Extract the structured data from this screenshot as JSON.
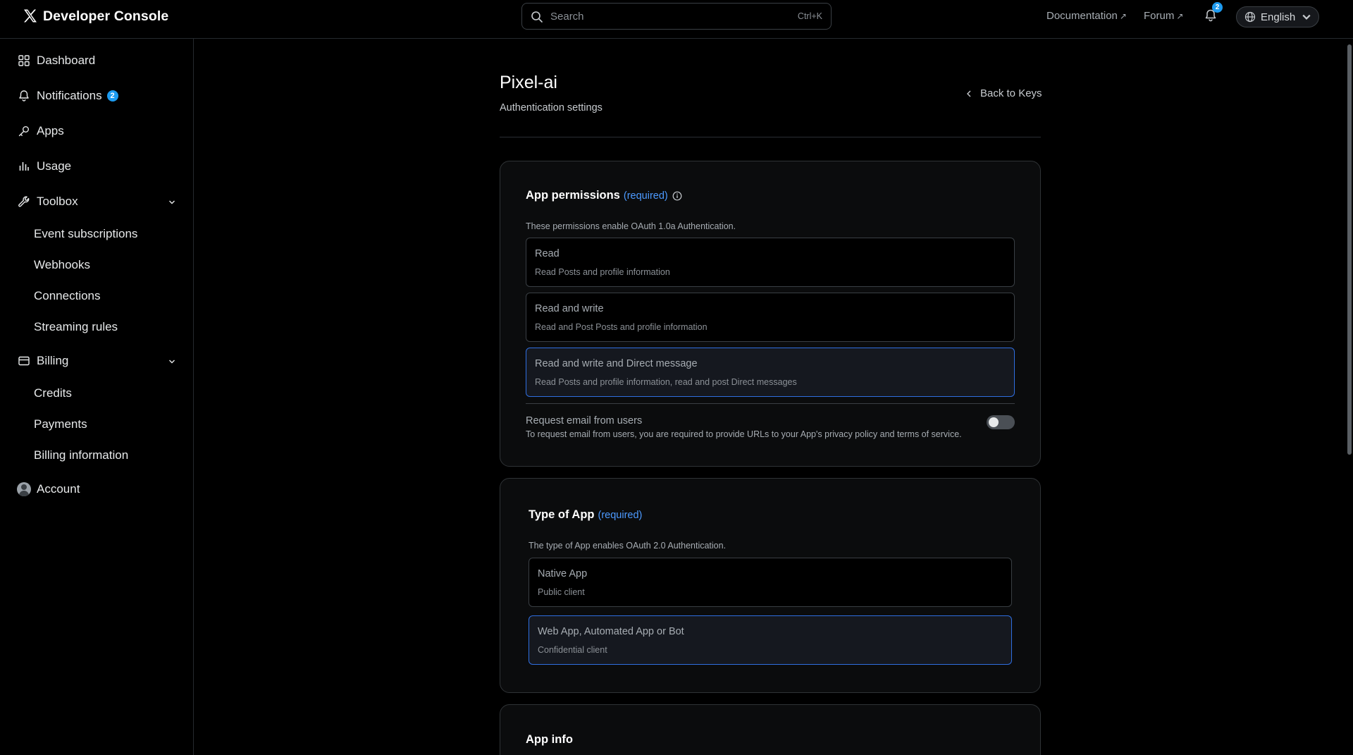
{
  "header": {
    "title": "Developer Console",
    "search_placeholder": "Search",
    "search_shortcut": "Ctrl+K",
    "documentation_label": "Documentation",
    "forum_label": "Forum",
    "notification_count": "2",
    "language": "English",
    "external_arrow": "↗"
  },
  "sidebar": {
    "dashboard": "Dashboard",
    "notifications": "Notifications",
    "notifications_badge": "2",
    "apps": "Apps",
    "usage": "Usage",
    "toolbox": "Toolbox",
    "toolbox_items": [
      "Event subscriptions",
      "Webhooks",
      "Connections",
      "Streaming rules"
    ],
    "billing": "Billing",
    "billing_items": [
      "Credits",
      "Payments",
      "Billing information"
    ],
    "account": "Account"
  },
  "page": {
    "title": "Pixel-ai",
    "subtitle": "Authentication settings",
    "back_label": "Back to Keys"
  },
  "permissions": {
    "title": "App permissions",
    "required": "(required)",
    "description": "These permissions enable OAuth 1.0a Authentication.",
    "options": [
      {
        "title": "Read",
        "desc": "Read Posts and profile information",
        "selected": false
      },
      {
        "title": "Read and write",
        "desc": "Read and Post Posts and profile information",
        "selected": false
      },
      {
        "title": "Read and write and Direct message",
        "desc": "Read Posts and profile information, read and post Direct messages",
        "selected": true
      }
    ],
    "email_label": "Request email from users",
    "email_desc": "To request email from users, you are required to provide URLs to your App's privacy policy and terms of service.",
    "email_enabled": false
  },
  "app_type": {
    "title": "Type of App",
    "required": "(required)",
    "description": "The type of App enables OAuth 2.0 Authentication.",
    "options": [
      {
        "title": "Native App",
        "desc": "Public client",
        "selected": false
      },
      {
        "title": "Web App, Automated App or Bot",
        "desc": "Confidential client",
        "selected": true
      }
    ]
  },
  "app_info": {
    "title": "App info"
  },
  "colors": {
    "accent": "#1d9bf0",
    "required_text": "#4c9aff",
    "selected_border": "#2f6ee0",
    "background": "#000000"
  }
}
